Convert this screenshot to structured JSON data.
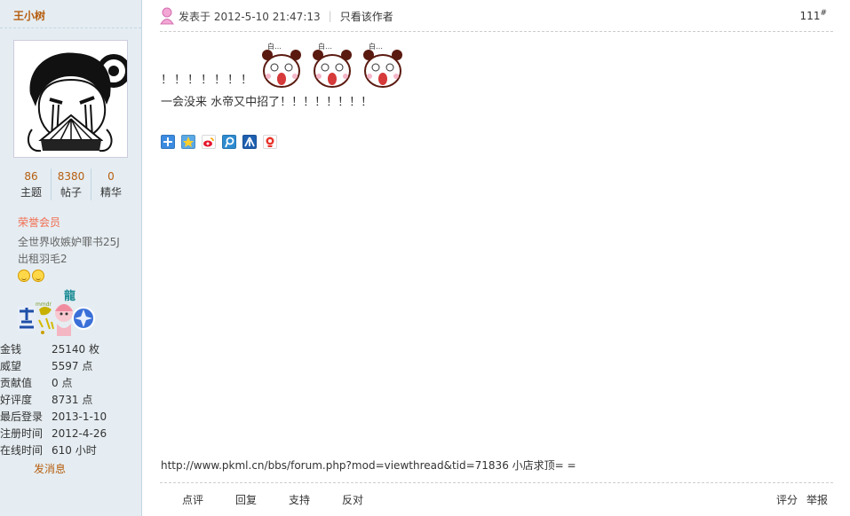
{
  "author": {
    "name": "王小树",
    "stats": [
      {
        "value": "86",
        "label": "主题"
      },
      {
        "value": "8380",
        "label": "帖子"
      },
      {
        "value": "0",
        "label": "精华"
      }
    ],
    "rank": "荣誉会员",
    "custom_title": "全世界收嫉妒罪书25J出租羽毛2",
    "medal_text": "龍",
    "info": [
      {
        "key": "金钱",
        "value": "25140 枚"
      },
      {
        "key": "威望",
        "value": "5597 点"
      },
      {
        "key": "贡献值",
        "value": "0 点"
      },
      {
        "key": "好评度",
        "value": "8731 点"
      },
      {
        "key": "最后登录",
        "value": "2013-1-10"
      },
      {
        "key": "注册时间",
        "value": "2012-4-26"
      },
      {
        "key": "在线时间",
        "value": "610 小时"
      }
    ],
    "send_message": "发消息"
  },
  "post": {
    "posted_on": "发表于 2012-5-10 21:47:13",
    "author_only": "只看该作者",
    "floor_number": "111",
    "floor_suffix": "#",
    "line1": "！！！！！！！",
    "line2": "一会没来 水帝又中招了！！！！！！！！",
    "emoticon_bubble": "白…",
    "share_icons": [
      "add-share-icon",
      "qzone-icon",
      "sina-weibo-icon",
      "tencent-weibo-icon",
      "renren-icon",
      "kaixin-icon"
    ],
    "signature": "http://www.pkml.cn/bbs/forum.php?mod=viewthread&tid=71836 小店求顶= ="
  },
  "actions": {
    "comment": "点评",
    "reply": "回复",
    "support": "支持",
    "oppose": "反对",
    "rate": "评分",
    "report": "举报"
  },
  "colors": {
    "sidebar_bg": "#e5edf2",
    "accent_orange": "#b65e0f",
    "rank_color": "#f26c4f"
  }
}
